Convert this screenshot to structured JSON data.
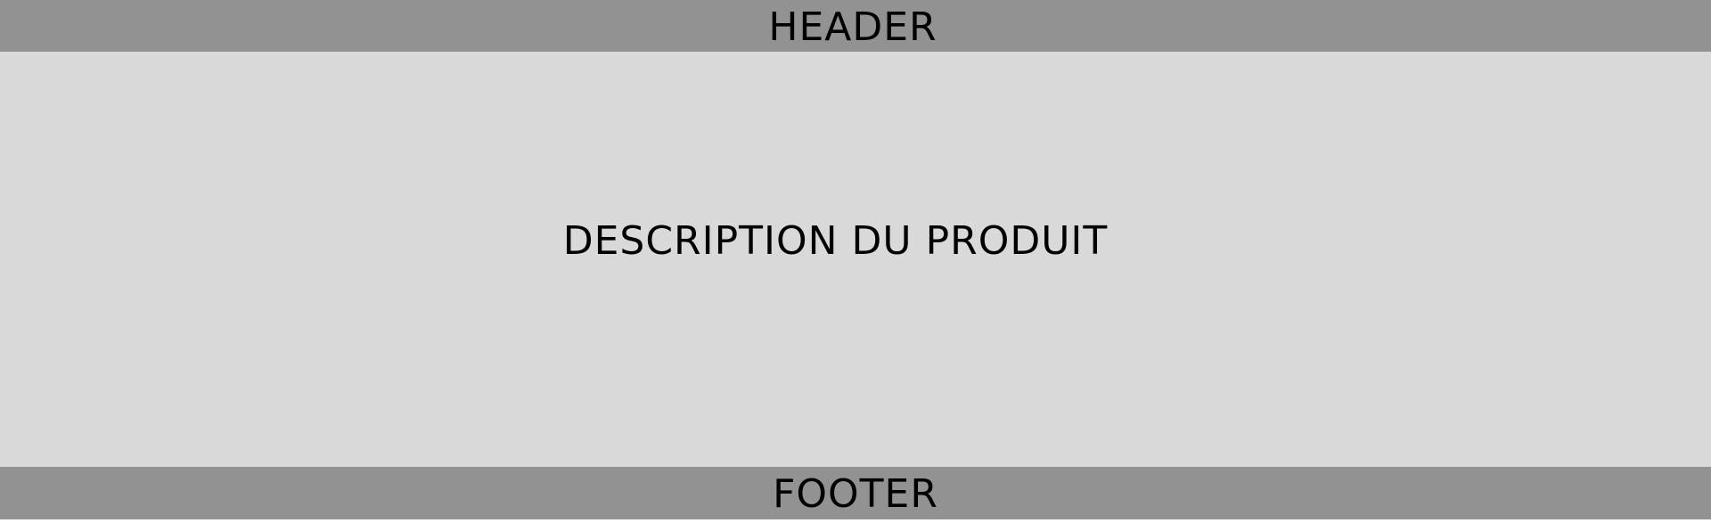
{
  "header": {
    "title": "HEADER",
    "background": "#929292"
  },
  "main": {
    "title": "DESCRIPTION DU PRODUIT",
    "background": "#d9d9d9"
  },
  "footer": {
    "title": "FOOTER",
    "background": "#929292"
  }
}
